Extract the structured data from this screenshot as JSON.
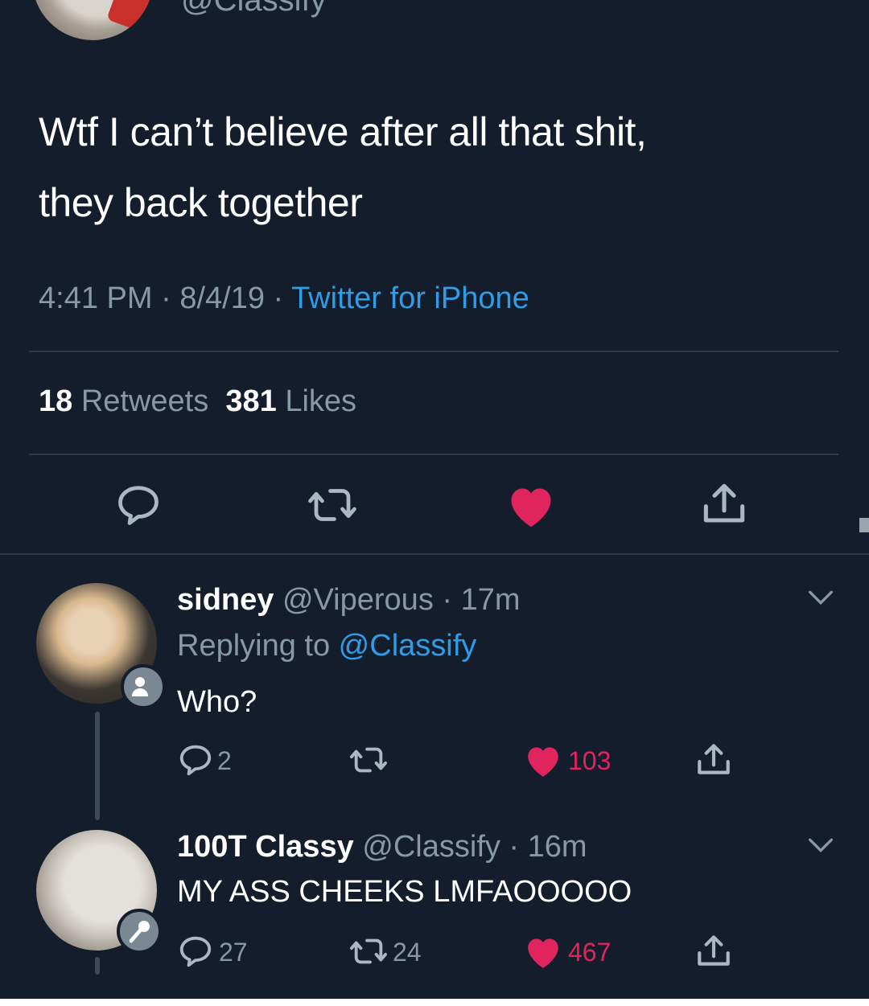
{
  "main_tweet": {
    "handle_partial": "@Classify",
    "text_line1": "Wtf I can’t believe after all that shit,",
    "text_line2": "they back together",
    "time": "4:41 PM",
    "sep1": " · ",
    "date": "8/4/19",
    "sep2": " · ",
    "source": "Twitter for iPhone",
    "retweets_count": "18",
    "retweets_label": " Retweets",
    "likes_count": "381",
    "likes_label": " Likes"
  },
  "replies": [
    {
      "name": "sidney",
      "handle": " @Viperous",
      "time": " · 17m",
      "replying_label": "Replying to ",
      "replying_to": "@Classify",
      "text": "Who?",
      "reply_count": "2",
      "retweet_count": "",
      "like_count": "103"
    },
    {
      "name": "100T Classy",
      "handle": " @Classify",
      "time": " · 16m",
      "text": "MY ASS CHEEKS LMFAOOOOO",
      "reply_count": "27",
      "retweet_count": "24",
      "like_count": "467"
    }
  ],
  "icons": {
    "reply": "reply-icon",
    "retweet": "retweet-icon",
    "like": "heart-icon",
    "share": "share-icon",
    "more": "chevron-down-icon"
  },
  "colors": {
    "background": "#141d2b",
    "accent_blue": "#2f9ce8",
    "like_red": "#e0245e",
    "muted": "#8899a6"
  }
}
